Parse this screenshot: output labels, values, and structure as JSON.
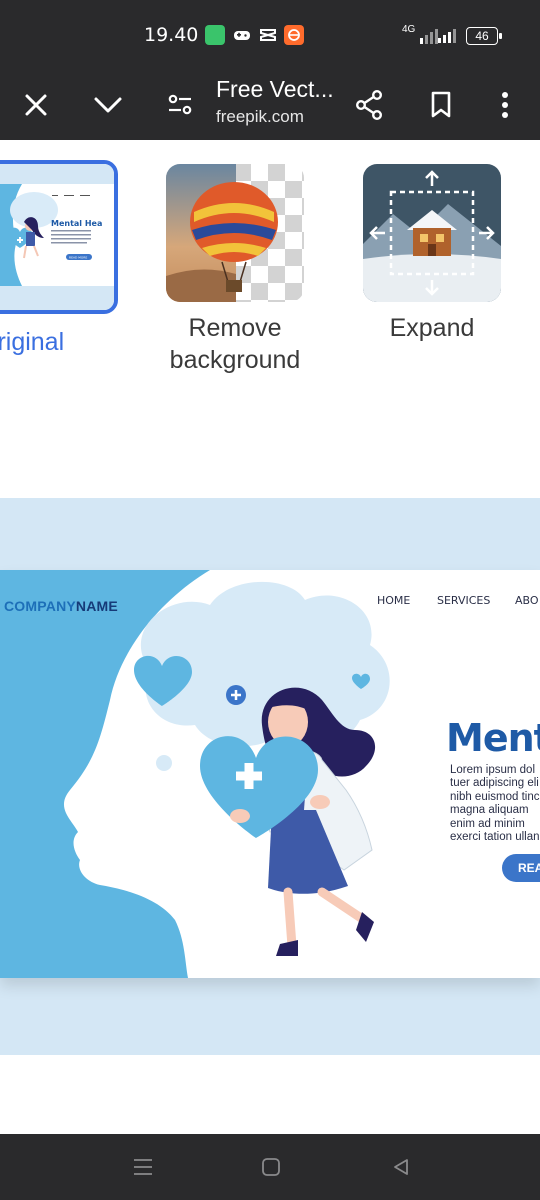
{
  "status_bar": {
    "time": "19.40",
    "network": "4G",
    "battery": "46",
    "app_icons": [
      "green-app-icon",
      "gamepad-icon",
      "capcut-icon",
      "orange-app-icon"
    ]
  },
  "toolbar": {
    "title": "Free Vect...",
    "domain": "freepik.com",
    "icons": [
      "close-icon",
      "chevron-down-icon",
      "site-settings-icon",
      "share-icon",
      "bookmark-icon",
      "more-vert-icon"
    ]
  },
  "options": {
    "original_label": "Original",
    "remove_bg_label_line1": "Remove",
    "remove_bg_label_line2": "background",
    "expand_label": "Expand"
  },
  "preview": {
    "company_prefix": "COMPANY",
    "company_suffix": "NAME",
    "nav": [
      "HOME",
      "SERVICES",
      "ABO"
    ],
    "title": "Menta",
    "body_lines": [
      "Lorem ipsum dol",
      "tuer adipiscing eli",
      "nibh euismod tinc",
      "magna aliquam",
      "enim ad minim",
      "exerci tation ullan"
    ],
    "button": "REA"
  },
  "thumb_original": {
    "title": "Mental Hea",
    "button": "READ MORE"
  },
  "colors": {
    "bar_bg": "#2a2a2c",
    "accent": "#3a6fe0",
    "preview_bg": "#d4e7f5",
    "head_blue": "#5eb6e1",
    "title_blue": "#1e5aa6"
  }
}
